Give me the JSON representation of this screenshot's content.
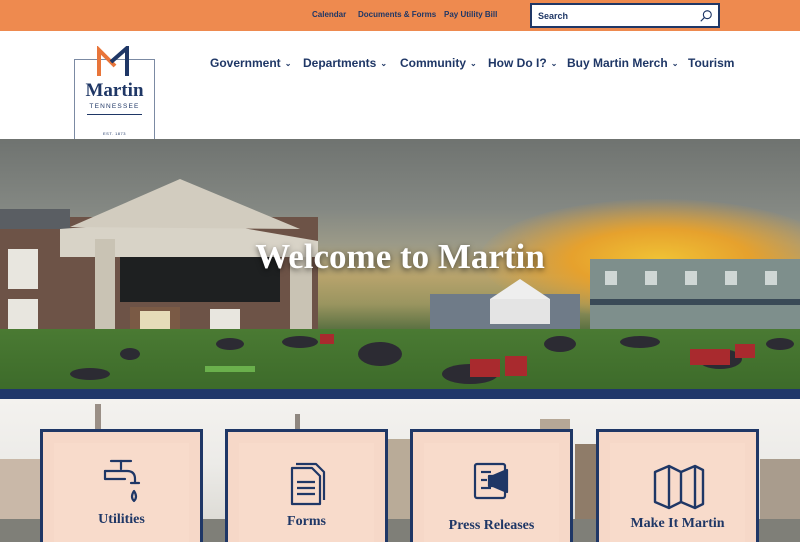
{
  "topbar": {
    "links": [
      "Calendar",
      "Documents & Forms",
      "Pay Utility Bill"
    ],
    "search_placeholder": "Search",
    "search_icon": "search-icon"
  },
  "logo": {
    "name": "Martin",
    "state": "TENNESSEE",
    "est": "EST. 1873"
  },
  "nav": {
    "items": [
      {
        "label": "Government",
        "dropdown": "⌄"
      },
      {
        "label": "Departments",
        "dropdown": "⌄"
      },
      {
        "label": "Community",
        "dropdown": "⌄"
      },
      {
        "label": "How Do I?",
        "dropdown": "⌄"
      },
      {
        "label": "Buy Martin Merch",
        "dropdown": "⌄"
      },
      {
        "label": "Tourism"
      }
    ]
  },
  "hero": {
    "title": "Welcome to Martin"
  },
  "quick_links": [
    {
      "label": "Utilities",
      "icon": "faucet-icon"
    },
    {
      "label": "Forms",
      "icon": "document-icon"
    },
    {
      "label": "Press Releases",
      "icon": "megaphone-icon"
    },
    {
      "label": "Make It Martin",
      "icon": "map-icon"
    }
  ],
  "colors": {
    "accent_orange": "#ee8a4f",
    "navy": "#1f3766",
    "card_fill": "#f8dbcb"
  }
}
